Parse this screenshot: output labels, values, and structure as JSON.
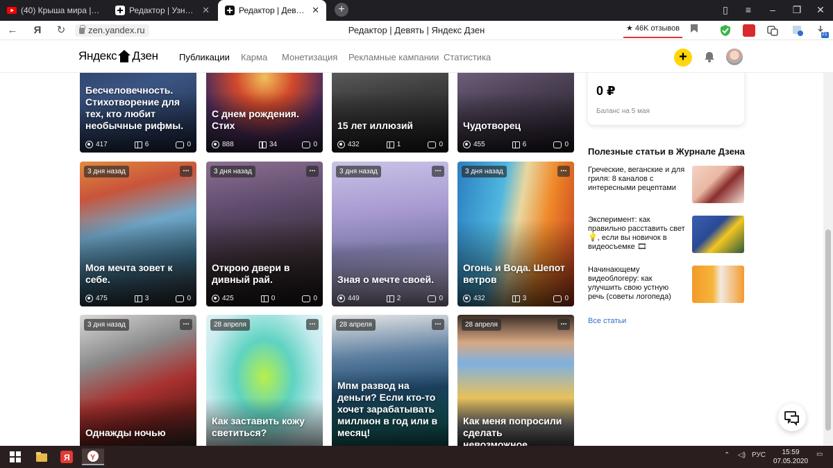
{
  "browser": {
    "tabs": [
      {
        "title": "(40) Крыша мира | Сезон",
        "icon": "youtube-icon"
      },
      {
        "title": "Редактор | Узнаете себя?",
        "icon": "dzen-editor-icon"
      },
      {
        "title": "Редактор | Девять | Янд",
        "icon": "dzen-editor-icon",
        "active": true
      }
    ],
    "url": "zen.yandex.ru",
    "page_title": "Редактор | Девять | Яндекс Дзен",
    "reviews_label": "★ 46K отзывов",
    "extension_badge": "21"
  },
  "header": {
    "logo_left": "Яндекс",
    "logo_right": "Дзен",
    "nav": [
      "Публикации",
      "Карма",
      "Монетизация",
      "Рекламные кампании",
      "Статистика"
    ],
    "plus_label": "+"
  },
  "cards": [
    {
      "title": "Бесчеловечность. Стихотворение для тех, кто любит необычные рифмы.",
      "views": "417",
      "reads": "6",
      "comments": "0",
      "badge": ""
    },
    {
      "title": "С днем рождения. Стих",
      "views": "888",
      "reads": "34",
      "comments": "0",
      "badge": ""
    },
    {
      "title": "15 лет иллюзий",
      "views": "432",
      "reads": "1",
      "comments": "0",
      "badge": ""
    },
    {
      "title": "Чудотворец",
      "views": "455",
      "reads": "6",
      "comments": "0",
      "badge": ""
    },
    {
      "title": "Моя мечта зовет к себе.",
      "views": "475",
      "reads": "3",
      "comments": "0",
      "badge": "3 дня назад"
    },
    {
      "title": "Открою двери в дивный рай.",
      "views": "425",
      "reads": "0",
      "comments": "0",
      "badge": "3 дня назад"
    },
    {
      "title": "Зная о мечте своей.",
      "views": "449",
      "reads": "2",
      "comments": "0",
      "badge": "3 дня назад"
    },
    {
      "title": "Огонь и Вода. Шепот ветров",
      "views": "432",
      "reads": "3",
      "comments": "0",
      "badge": "3 дня назад"
    },
    {
      "title": "Однажды ночью",
      "badge": "3 дня назад"
    },
    {
      "title": "Как заставить кожу светиться?",
      "badge": "28 апреля"
    },
    {
      "title": "Мпм развод на деньги? Если кто-то хочет зарабатывать миллион в год или в месяц!",
      "badge": "28 апреля"
    },
    {
      "title": "Как меня попросили сделать невозможное.",
      "badge": "28 апреля"
    }
  ],
  "sidebar": {
    "balance_amount": "0 ₽",
    "balance_date": "Баланс на 5 мая",
    "useful_heading": "Полезные статьи в Журнале Дзена",
    "articles": [
      {
        "title": "Греческие, веганские и для гриля: 8 каналов с интересными рецептами"
      },
      {
        "title": "Эксперимент: как правильно расставить свет 💡, если вы новичок в видеосъемке 🎞"
      },
      {
        "title": "Начинающему видеоблогеру: как улучшить свою устную речь (советы логопеда)"
      }
    ],
    "all_articles": "Все статьи"
  },
  "taskbar": {
    "lang": "РУС",
    "time": "15:59",
    "date": "07.05.2020"
  }
}
